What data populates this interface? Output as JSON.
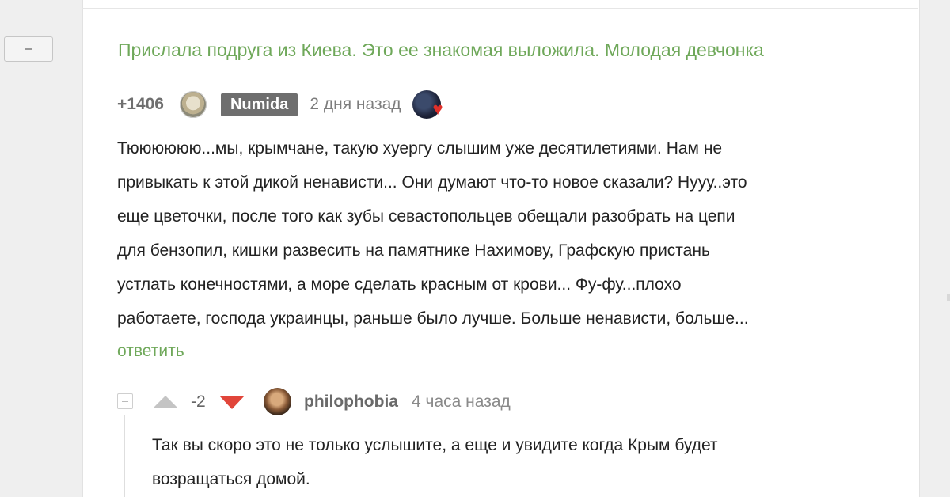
{
  "post": {
    "title": "Прислала подруга из Киева. Это ее знакомая выложила. Молодая девчонка"
  },
  "comment": {
    "rating": "+1406",
    "username": "Numida",
    "time": "2 дня назад",
    "lines": [
      "Тюююююю...мы, крымчане, такую хуергу слышим уже десятилетиями. Нам не",
      "привыкать к этой дикой ненависти... Они думают что-то новое сказали? Нууу..это",
      "еще цветочки, после того как зубы севастопольцев обещали разобрать на цепи",
      "для бензопил, кишки развесить на памятнике Нахимову, Графскую пристань",
      "устлать конечностями, а море сделать красным от крови... Фу-фу...плохо",
      "работаете, господа украинцы, раньше было лучше. Больше ненависти, больше..."
    ],
    "reply_label": "ответить"
  },
  "reply": {
    "score": "-2",
    "username": "philophobia",
    "time": "4 часа назад",
    "lines": [
      "Так вы скоро это не только услышите, а еще и увидите когда Крым будет",
      "возращаться домой."
    ]
  },
  "colors": {
    "accent_green": "#6fa85a",
    "downvote_red": "#e1453a",
    "badge_gray": "#6e6e6e"
  },
  "icons": {
    "collapse": "minus-icon",
    "upvote": "triangle-up-icon",
    "downvote": "triangle-down-icon",
    "award": "heart-award-icon"
  }
}
